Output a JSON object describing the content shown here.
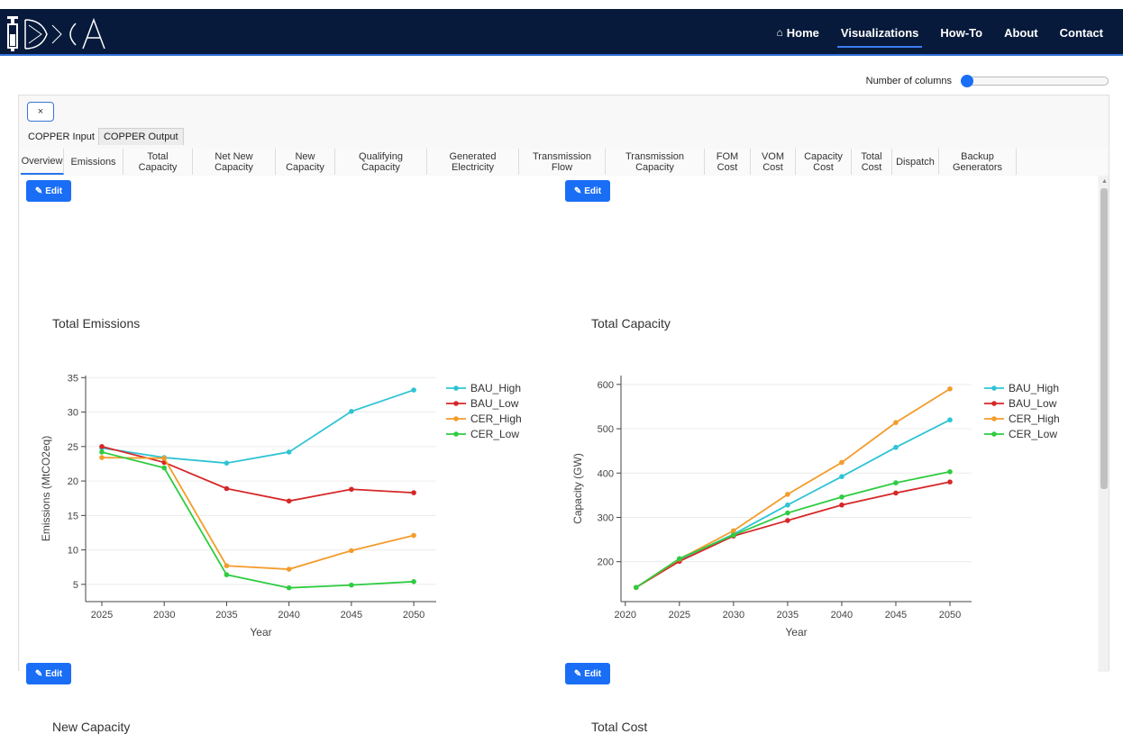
{
  "nav": {
    "items": [
      {
        "label": "Home",
        "icon": "home-icon"
      },
      {
        "label": "Visualizations",
        "active": true
      },
      {
        "label": "How-To"
      },
      {
        "label": "About"
      },
      {
        "label": "Contact"
      }
    ]
  },
  "controls": {
    "columns_label": "Number of columns",
    "close_label": "×"
  },
  "tabs_level1": [
    {
      "label": "COPPER Input"
    },
    {
      "label": "COPPER Output",
      "active": true
    }
  ],
  "tabs_level2": [
    {
      "label": "Overview",
      "active": true
    },
    {
      "label": "Emissions"
    },
    {
      "label": "Total\nCapacity"
    },
    {
      "label": "Net New\nCapacity"
    },
    {
      "label": "New\nCapacity"
    },
    {
      "label": "Qualifying\nCapacity"
    },
    {
      "label": "Generated\nElectricity"
    },
    {
      "label": "Transmission\nFlow"
    },
    {
      "label": "Transmission\nCapacity"
    },
    {
      "label": "FOM\nCost"
    },
    {
      "label": "VOM\nCost"
    },
    {
      "label": "Capacity\nCost"
    },
    {
      "label": "Total\nCost"
    },
    {
      "label": "Dispatch"
    },
    {
      "label": "Backup\nGenerators"
    }
  ],
  "edit_label": "Edit",
  "chart_data": [
    {
      "type": "line",
      "title": "Total Emissions",
      "xlabel": "Year",
      "ylabel": "Emissions (MtCO2eq)",
      "x": [
        2025,
        2030,
        2035,
        2040,
        2045,
        2050
      ],
      "xticks": [
        2025,
        2030,
        2035,
        2040,
        2045,
        2050
      ],
      "yticks": [
        5,
        10,
        15,
        20,
        25,
        30,
        35
      ],
      "xlim": [
        2023.7,
        2051.8
      ],
      "ylim": [
        2.5,
        35.3
      ],
      "grid": true,
      "legend": "right",
      "series": [
        {
          "name": "BAU_High",
          "color": "#2ec4d4",
          "values": [
            24.8,
            23.4,
            22.6,
            24.2,
            30.1,
            33.2
          ]
        },
        {
          "name": "BAU_Low",
          "color": "#d62728",
          "values": [
            25.0,
            22.7,
            18.9,
            17.1,
            18.8,
            18.3
          ]
        },
        {
          "name": "CER_High",
          "color": "#f39c2b",
          "values": [
            23.4,
            23.3,
            7.7,
            7.2,
            9.9,
            12.1
          ]
        },
        {
          "name": "CER_Low",
          "color": "#2ecc40",
          "values": [
            24.2,
            21.9,
            6.4,
            4.5,
            4.9,
            5.4
          ]
        }
      ]
    },
    {
      "type": "line",
      "title": "Total Capacity",
      "xlabel": "Year",
      "ylabel": "Capacity (GW)",
      "x": [
        2021,
        2025,
        2030,
        2035,
        2040,
        2045,
        2050
      ],
      "xticks": [
        2020,
        2025,
        2030,
        2035,
        2040,
        2045,
        2050
      ],
      "yticks": [
        200,
        300,
        400,
        500,
        600
      ],
      "xlim": [
        2019.6,
        2052.0
      ],
      "ylim": [
        110,
        620
      ],
      "grid": true,
      "legend": "right",
      "series": [
        {
          "name": "BAU_High",
          "color": "#2ec4d4",
          "values": [
            142,
            205,
            262,
            328,
            392,
            458,
            520
          ]
        },
        {
          "name": "BAU_Low",
          "color": "#d62728",
          "values": [
            142,
            201,
            258,
            293,
            328,
            355,
            380
          ]
        },
        {
          "name": "CER_High",
          "color": "#f39c2b",
          "values": [
            142,
            206,
            270,
            352,
            424,
            514,
            590
          ]
        },
        {
          "name": "CER_Low",
          "color": "#2ecc40",
          "values": [
            142,
            207,
            260,
            310,
            346,
            378,
            403
          ]
        }
      ]
    }
  ],
  "more_charts": {
    "left_title": "New Capacity",
    "right_title": "Total Cost"
  }
}
